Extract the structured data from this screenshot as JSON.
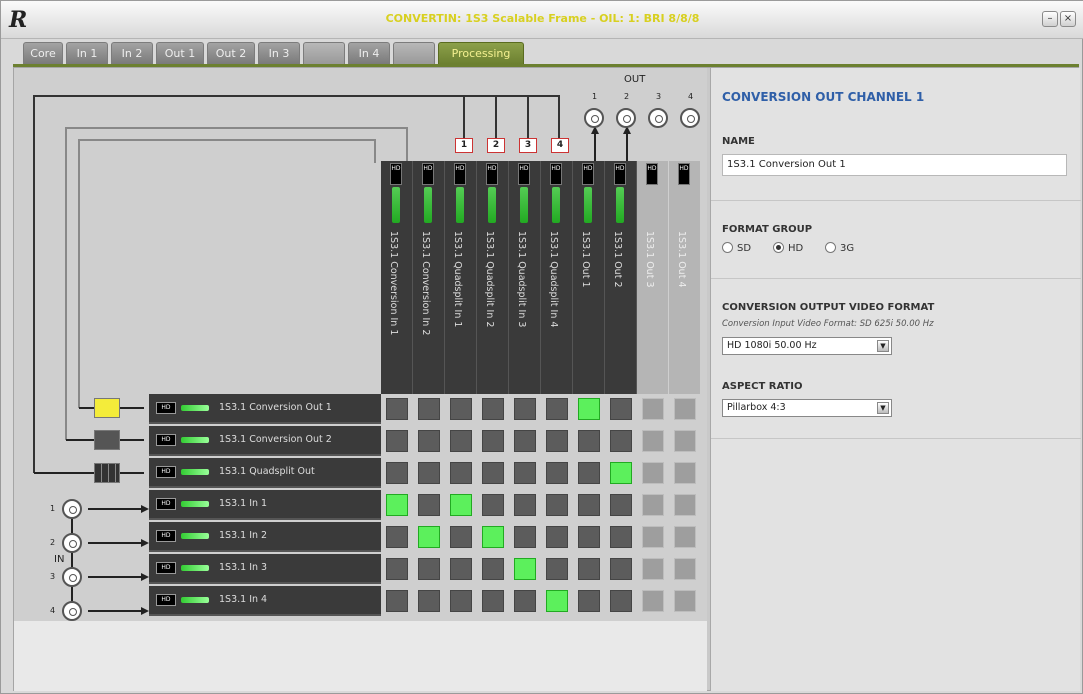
{
  "window": {
    "logo": "R",
    "title": "CONVERTIN: 1S3 Scalable Frame - OIL: 1: BRI 8/8/8",
    "controls": [
      "–",
      "×"
    ]
  },
  "tabs": [
    {
      "label": "Core",
      "state": "normal"
    },
    {
      "label": "In 1",
      "state": "normal"
    },
    {
      "label": "In 2",
      "state": "normal"
    },
    {
      "label": "Out 1",
      "state": "normal"
    },
    {
      "label": "Out 2",
      "state": "normal"
    },
    {
      "label": "In 3",
      "state": "normal"
    },
    {
      "label": "",
      "state": "disabled"
    },
    {
      "label": "In 4",
      "state": "normal"
    },
    {
      "label": "",
      "state": "disabled"
    },
    {
      "label": "Processing",
      "state": "active"
    }
  ],
  "matrix": {
    "out_label": "OUT",
    "in_label": "IN",
    "out_numbers": [
      "1",
      "2",
      "3",
      "4"
    ],
    "in_numbers": [
      "1",
      "2",
      "3",
      "4"
    ],
    "quad_boxes": [
      "1",
      "2",
      "3",
      "4"
    ],
    "columns": [
      {
        "label": "1S3.1 Conversion In 1",
        "enabled": true
      },
      {
        "label": "1S3.1 Conversion In 2",
        "enabled": true
      },
      {
        "label": "1S3.1 Quadsplit In 1",
        "enabled": true
      },
      {
        "label": "1S3.1 Quadsplit In 2",
        "enabled": true
      },
      {
        "label": "1S3.1 Quadsplit In 3",
        "enabled": true
      },
      {
        "label": "1S3.1 Quadsplit In 4",
        "enabled": true
      },
      {
        "label": "1S3.1 Out 1",
        "enabled": true
      },
      {
        "label": "1S3.1 Out 2",
        "enabled": true
      },
      {
        "label": "1S3.1 Out 3",
        "enabled": false
      },
      {
        "label": "1S3.1 Out 4",
        "enabled": false
      }
    ],
    "col_badge": "HD",
    "rows": [
      {
        "badge": "HD",
        "label": "1S3.1 Conversion Out 1"
      },
      {
        "badge": "HD",
        "label": "1S3.1 Conversion Out 2"
      },
      {
        "badge": "HD",
        "label": "1S3.1 Quadsplit Out"
      },
      {
        "badge": "HD",
        "label": "1S3.1 In 1"
      },
      {
        "badge": "HD",
        "label": "1S3.1 In 2"
      },
      {
        "badge": "HD",
        "label": "1S3.1 In 3"
      },
      {
        "badge": "HD",
        "label": "1S3.1 In 4"
      }
    ],
    "crosspoints": [
      [
        0,
        6
      ],
      [
        2,
        7
      ],
      [
        3,
        0
      ],
      [
        3,
        2
      ],
      [
        4,
        1
      ],
      [
        4,
        3
      ],
      [
        5,
        4
      ],
      [
        6,
        5
      ]
    ]
  },
  "panel": {
    "title": "CONVERSION OUT CHANNEL 1",
    "name_label": "NAME",
    "name_value": "1S3.1 Conversion Out 1",
    "format_group_label": "FORMAT GROUP",
    "format_options": [
      "SD",
      "HD",
      "3G"
    ],
    "format_selected": "HD",
    "video_format_label": "CONVERSION OUTPUT VIDEO FORMAT",
    "input_format_note": "Conversion Input Video Format: SD 625i 50.00 Hz",
    "video_format_value": "HD 1080i 50.00 Hz",
    "aspect_label": "ASPECT RATIO",
    "aspect_value": "Pillarbox 4:3"
  },
  "colors": {
    "accent": "#2f5fa8",
    "active_tab": "#6c8030",
    "crosspoint_on": "#5cf05c",
    "connector_box": "#cc3333"
  }
}
